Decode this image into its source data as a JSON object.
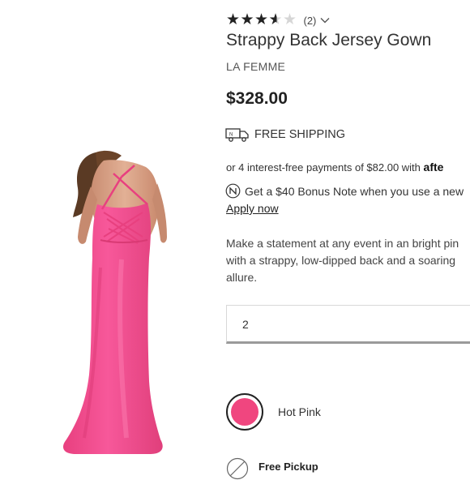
{
  "product": {
    "rating": {
      "stars_filled": 3.5,
      "stars_total": 5,
      "review_count": "(2)"
    },
    "title": "Strappy Back Jersey Gown",
    "brand": "LA FEMME",
    "price": "$328.00"
  },
  "shipping": {
    "icon": "truck-icon",
    "label": "FREE SHIPPING"
  },
  "afterpay": {
    "text": "or 4 interest-free payments of $82.00 with",
    "brand_partial": "afte"
  },
  "bonus": {
    "icon": "note-icon",
    "text": "Get a $40 Bonus Note when you use a new",
    "link": "Apply now"
  },
  "description": {
    "line1": "Make a statement at any event in an bright pin",
    "line2": "with a strappy, low-dipped back and a soaring",
    "line3": "allure."
  },
  "quantity": {
    "value": "2"
  },
  "color": {
    "selected": "Hot Pink",
    "hex": "#f0467f"
  },
  "pickup": {
    "icon": "pickup-unavailable-icon",
    "label": "Free Pickup"
  },
  "image": {
    "dress_color": "#f25395"
  }
}
